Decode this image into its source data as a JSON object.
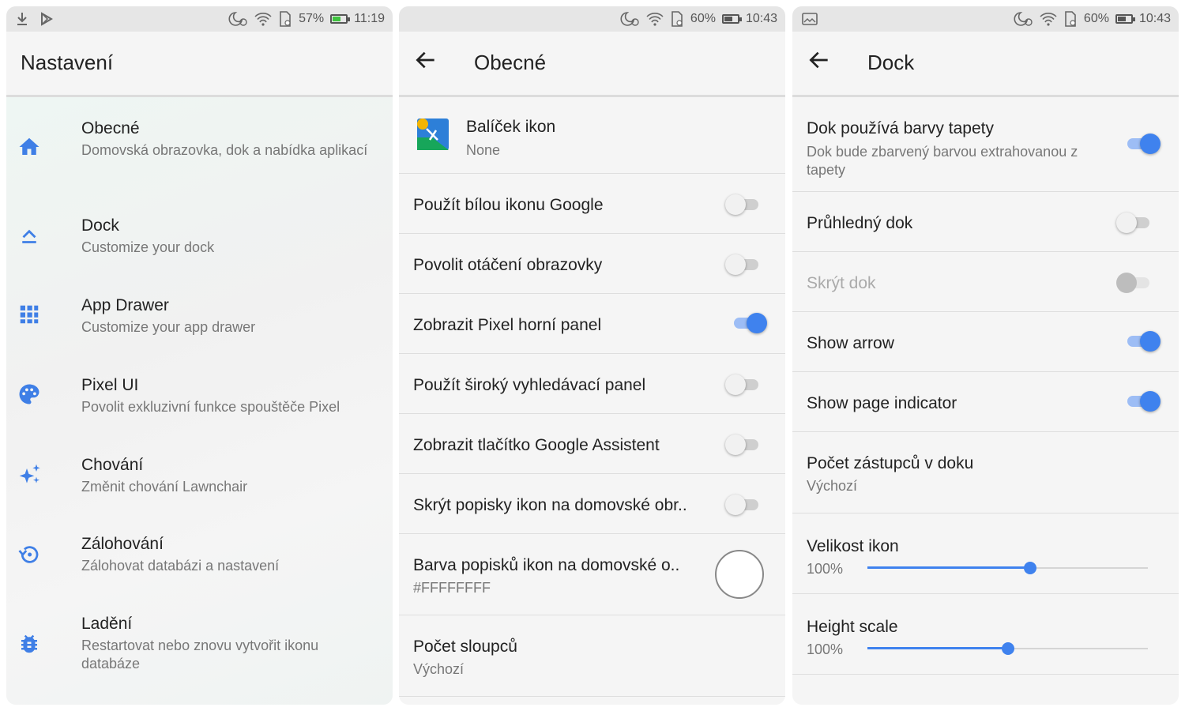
{
  "panel1": {
    "status": {
      "battery": "57%",
      "time": "11:19",
      "battery_color": "#3fc33f"
    },
    "title": "Nastavení",
    "items": [
      {
        "title": "Obecné",
        "subtitle": "Domovská obrazovka, dok a nabídka aplikací",
        "icon": "home-icon"
      },
      {
        "title": "Dock",
        "subtitle": "Customize your dock",
        "icon": "dock-icon"
      },
      {
        "title": "App Drawer",
        "subtitle": "Customize your app drawer",
        "icon": "apps-grid-icon"
      },
      {
        "title": "Pixel UI",
        "subtitle": "Povolit exkluzivní funkce spouštěče Pixel",
        "icon": "palette-icon"
      },
      {
        "title": "Chování",
        "subtitle": "Změnit chování Lawnchair",
        "icon": "sparkle-icon"
      },
      {
        "title": "Zálohování",
        "subtitle": "Zálohovat databázi a nastavení",
        "icon": "backup-icon"
      },
      {
        "title": "Ladění",
        "subtitle": "Restartovat nebo znovu vytvořit ikonu databáze",
        "icon": "bug-icon"
      }
    ]
  },
  "panel2": {
    "status": {
      "battery": "60%",
      "time": "10:43"
    },
    "title": "Obecné",
    "icon_pack": {
      "title": "Balíček ikon",
      "value": "None"
    },
    "toggles": [
      {
        "label": "Použít bílou ikonu Google",
        "on": false
      },
      {
        "label": "Povolit otáčení obrazovky",
        "on": false
      },
      {
        "label": "Zobrazit Pixel horní panel",
        "on": true
      },
      {
        "label": "Použít široký vyhledávací panel",
        "on": false
      },
      {
        "label": "Zobrazit tlačítko Google Assistent",
        "on": false
      },
      {
        "label": "Skrýt popisky ikon na domovské obr..",
        "on": false
      }
    ],
    "label_color": {
      "title": "Barva popisků ikon na domovské o..",
      "value": "#FFFFFFFF"
    },
    "columns": {
      "title": "Počet sloupců",
      "value": "Výchozí"
    }
  },
  "panel3": {
    "status": {
      "battery": "60%",
      "time": "10:43"
    },
    "title": "Dock",
    "wallpaper_colors": {
      "title": "Dok používá barvy tapety",
      "subtitle": "Dok bude zbarvený barvou extrahovanou z tapety",
      "on": true
    },
    "toggles": [
      {
        "label": "Průhledný dok",
        "on": false,
        "disabled": false
      },
      {
        "label": "Skrýt dok",
        "on": false,
        "disabled": true
      },
      {
        "label": "Show arrow",
        "on": true,
        "disabled": false
      },
      {
        "label": "Show page indicator",
        "on": true,
        "disabled": false
      }
    ],
    "icon_count": {
      "title": "Počet zástupců v doku",
      "value": "Výchozí"
    },
    "icon_size": {
      "title": "Velikost ikon",
      "value": "100%",
      "fraction": 0.58
    },
    "height_scale": {
      "title": "Height scale",
      "value": "100%",
      "fraction": 0.5
    }
  },
  "colors": {
    "accent": "#3f82ee",
    "icon_blue": "#3f7fe6"
  }
}
